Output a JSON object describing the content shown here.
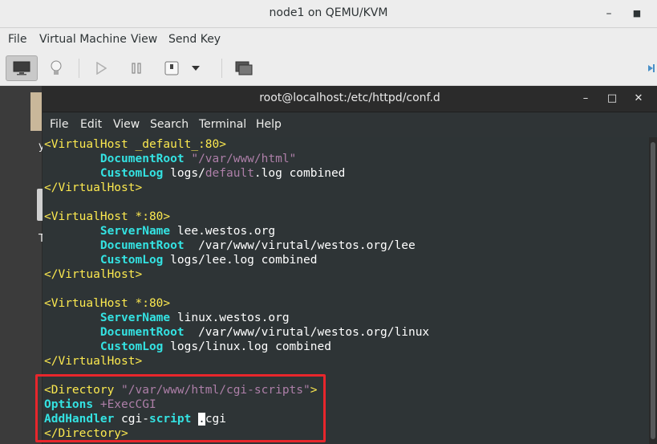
{
  "window": {
    "title": "node1 on QEMU/KVM",
    "minimize_label": "–",
    "close_label": "■"
  },
  "menubar": {
    "items": [
      "File",
      "Virtual Machine",
      "View",
      "Send Key"
    ]
  },
  "toolbar": {
    "icons": [
      "monitor-icon",
      "lightbulb-icon",
      "play-icon",
      "pause-icon",
      "power-icon",
      "dropdown-icon",
      "screenshot-icon",
      "fullscreen-icon"
    ]
  },
  "desktop": {
    "glyph_a": "y",
    "glyph_b": "T"
  },
  "terminal": {
    "title": "root@localhost:/etc/httpd/conf.d",
    "minimize_label": "–",
    "maximize_label": "□",
    "close_label": "✕",
    "menu": [
      "File",
      "Edit",
      "View",
      "Search",
      "Terminal",
      "Help"
    ],
    "lines": [
      [
        {
          "t": "<VirtualHost _default_:80>",
          "c": "tag"
        }
      ],
      [
        {
          "t": "        ",
          "c": ""
        },
        {
          "t": "DocumentRoot",
          "c": "kw"
        },
        {
          "t": " ",
          "c": ""
        },
        {
          "t": "\"/var/www/html\"",
          "c": "str"
        }
      ],
      [
        {
          "t": "        ",
          "c": ""
        },
        {
          "t": "CustomLog",
          "c": "kw"
        },
        {
          "t": " logs/",
          "c": ""
        },
        {
          "t": "default",
          "c": "str"
        },
        {
          "t": ".log combined",
          "c": ""
        }
      ],
      [
        {
          "t": "</VirtualHost>",
          "c": "tag"
        }
      ],
      [
        {
          "t": "",
          "c": ""
        }
      ],
      [
        {
          "t": "<VirtualHost *:80>",
          "c": "tag"
        }
      ],
      [
        {
          "t": "        ",
          "c": ""
        },
        {
          "t": "ServerName",
          "c": "kw"
        },
        {
          "t": " lee.westos.org",
          "c": ""
        }
      ],
      [
        {
          "t": "        ",
          "c": ""
        },
        {
          "t": "DocumentRoot",
          "c": "kw"
        },
        {
          "t": "  /var/www/virutal/westos.org/lee",
          "c": ""
        }
      ],
      [
        {
          "t": "        ",
          "c": ""
        },
        {
          "t": "CustomLog",
          "c": "kw"
        },
        {
          "t": " logs/lee.log combined",
          "c": ""
        }
      ],
      [
        {
          "t": "</VirtualHost>",
          "c": "tag"
        }
      ],
      [
        {
          "t": "",
          "c": ""
        }
      ],
      [
        {
          "t": "<VirtualHost *:80>",
          "c": "tag"
        }
      ],
      [
        {
          "t": "        ",
          "c": ""
        },
        {
          "t": "ServerName",
          "c": "kw"
        },
        {
          "t": " linux.westos.org",
          "c": ""
        }
      ],
      [
        {
          "t": "        ",
          "c": ""
        },
        {
          "t": "DocumentRoot",
          "c": "kw"
        },
        {
          "t": "  /var/www/virutal/westos.org/linux",
          "c": ""
        }
      ],
      [
        {
          "t": "        ",
          "c": ""
        },
        {
          "t": "CustomLog",
          "c": "kw"
        },
        {
          "t": " logs/linux.log combined",
          "c": ""
        }
      ],
      [
        {
          "t": "</VirtualHost>",
          "c": "tag"
        }
      ],
      [
        {
          "t": "",
          "c": ""
        }
      ],
      [
        {
          "t": "<Directory ",
          "c": "tag"
        },
        {
          "t": "\"/var/www/html/cgi-scripts\"",
          "c": "str"
        },
        {
          "t": ">",
          "c": "tag"
        }
      ],
      [
        {
          "t": "Options",
          "c": "kw"
        },
        {
          "t": " ",
          "c": ""
        },
        {
          "t": "+ExecCGI",
          "c": "str"
        }
      ],
      [
        {
          "t": "AddHandler",
          "c": "kw"
        },
        {
          "t": " cgi-",
          "c": ""
        },
        {
          "t": "script",
          "c": "kw"
        },
        {
          "t": " ",
          "c": ""
        },
        {
          "t": ".",
          "c": "cursor"
        },
        {
          "t": "cgi",
          "c": ""
        }
      ],
      [
        {
          "t": "</Directory>",
          "c": "tag"
        }
      ]
    ]
  },
  "colors": {
    "tag": "#fce94f",
    "string": "#ad7fa8",
    "keyword": "#34e2e2",
    "highlight": "#e8262c",
    "terminal_bg": "#2e3436"
  }
}
